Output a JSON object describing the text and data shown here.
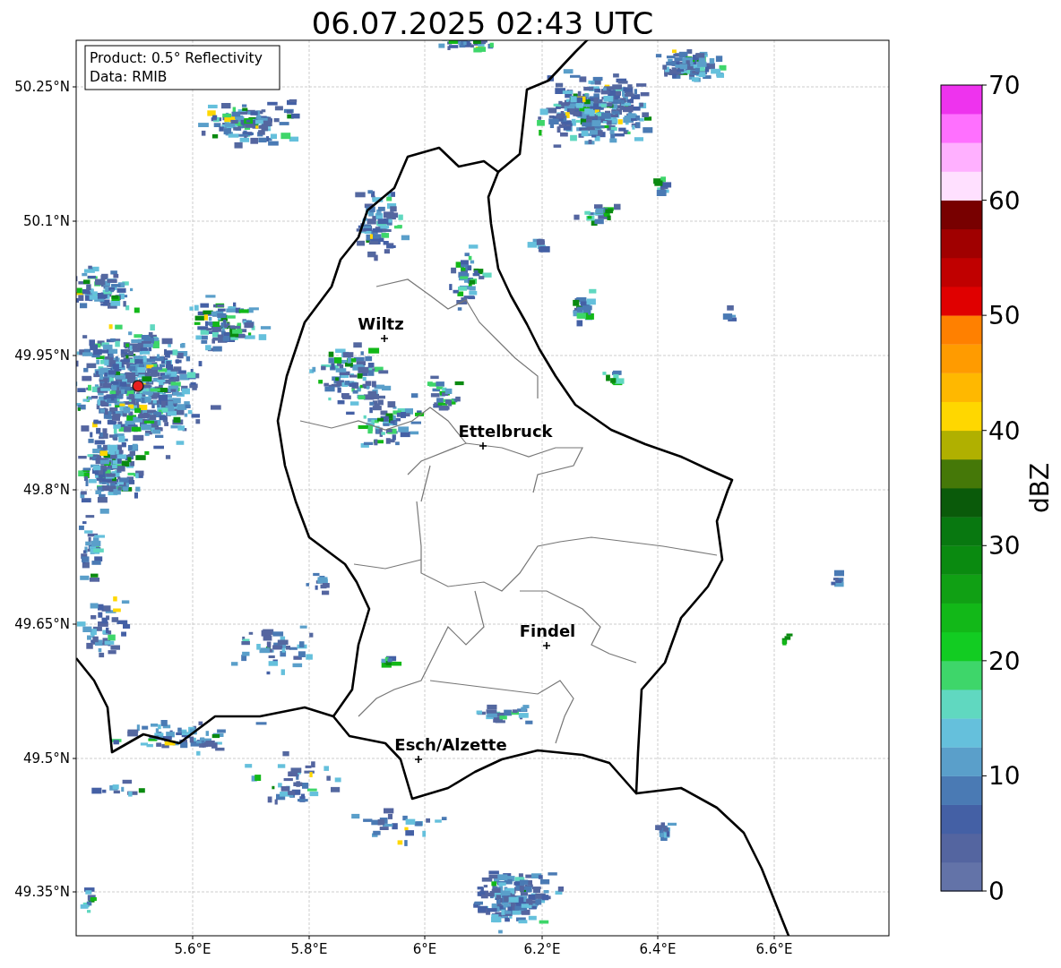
{
  "title": "06.07.2025 02:43 UTC",
  "info_box": {
    "lines": [
      "Product: 0.5° Reflectivity",
      "Data: RMIB"
    ]
  },
  "cities": [
    {
      "name": "Wiltz"
    },
    {
      "name": "Ettelbruck"
    },
    {
      "name": "Findel"
    },
    {
      "name": "Esch/Alzette"
    }
  ],
  "y_ticks": [
    "50.25°N",
    "50.1°N",
    "49.95°N",
    "49.8°N",
    "49.65°N",
    "49.5°N",
    "49.35°N"
  ],
  "x_ticks": [
    "5.6°E",
    "5.8°E",
    "6°E",
    "6.2°E",
    "6.4°E",
    "6.6°E"
  ],
  "colorbar": {
    "label": "dBZ",
    "ticks": [
      "70",
      "60",
      "50",
      "40",
      "30",
      "20",
      "10",
      "0"
    ],
    "segments": [
      {
        "color": "#6373a8"
      },
      {
        "color": "#5465a0"
      },
      {
        "color": "#4460a5"
      },
      {
        "color": "#4a7ab4"
      },
      {
        "color": "#5a9fca"
      },
      {
        "color": "#65c0dc"
      },
      {
        "color": "#60d8c0"
      },
      {
        "color": "#3ed66a"
      },
      {
        "color": "#12cc22"
      },
      {
        "color": "#12b818"
      },
      {
        "color": "#10a014"
      },
      {
        "color": "#0a8a10"
      },
      {
        "color": "#087810"
      },
      {
        "color": "#0a5a0a"
      },
      {
        "color": "#457808"
      },
      {
        "color": "#b0b000"
      },
      {
        "color": "#ffd700"
      },
      {
        "color": "#ffb800"
      },
      {
        "color": "#ff9b00"
      },
      {
        "color": "#ff8000"
      },
      {
        "color": "#e00000"
      },
      {
        "color": "#c00000"
      },
      {
        "color": "#a00000"
      },
      {
        "color": "#780000"
      },
      {
        "color": "#ffe0ff"
      },
      {
        "color": "#ffb0ff"
      },
      {
        "color": "#ff70ff"
      },
      {
        "color": "#ee33ee"
      }
    ]
  }
}
